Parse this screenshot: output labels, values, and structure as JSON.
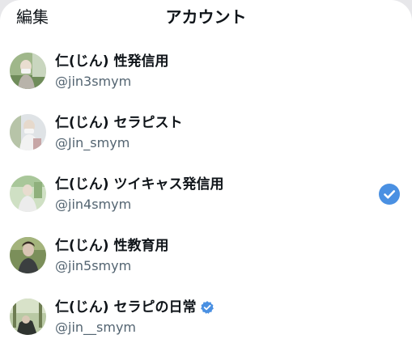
{
  "header": {
    "edit_label": "編集",
    "title": "アカウント"
  },
  "accounts": [
    {
      "name": "仁(じん) 性発信用",
      "handle": "@jin3smym",
      "selected": false,
      "verified": false
    },
    {
      "name": "仁(じん) セラピスト",
      "handle": "@Jin_smym",
      "selected": false,
      "verified": false
    },
    {
      "name": "仁(じん) ツイキャス発信用",
      "handle": "@jin4smym",
      "selected": true,
      "verified": false
    },
    {
      "name": "仁(じん) 性教育用",
      "handle": "@jin5smym",
      "selected": false,
      "verified": false
    },
    {
      "name": "仁(じん) セラピの日常",
      "handle": "@jin__smym",
      "selected": false,
      "verified": true
    }
  ],
  "colors": {
    "accent": "#4a90e2",
    "verified": "#4a90e2",
    "handle_text": "#536471"
  },
  "icons": {
    "selected": "checkmark-circle-icon",
    "verified": "verified-badge-icon"
  }
}
